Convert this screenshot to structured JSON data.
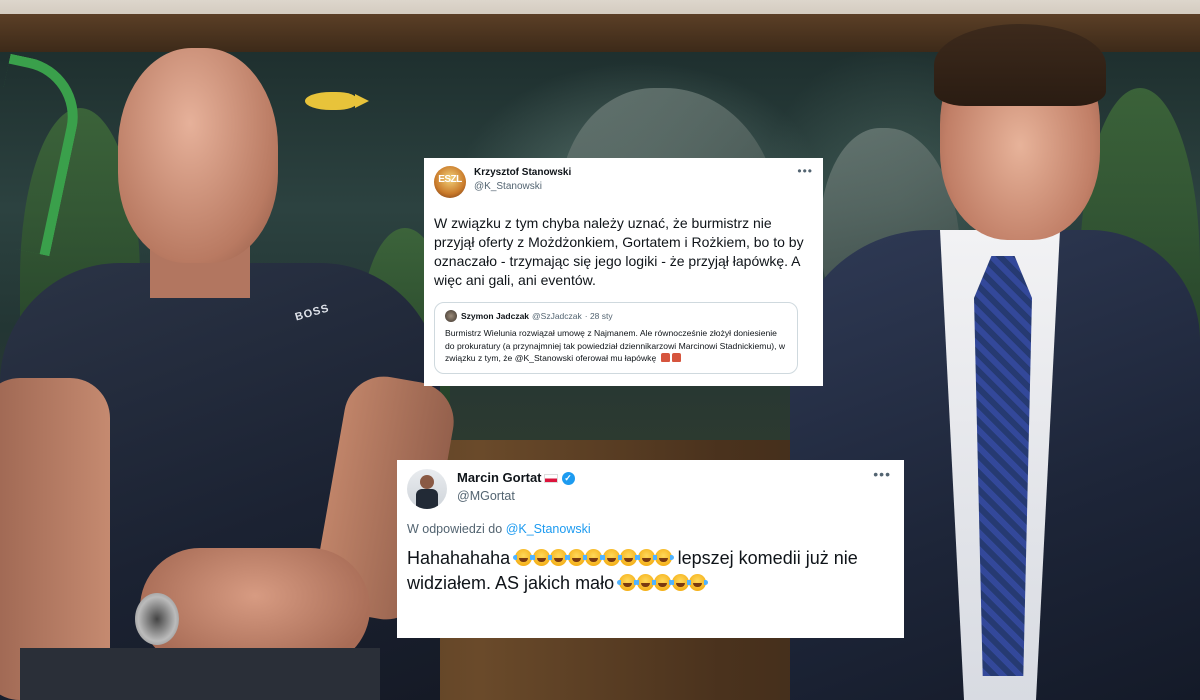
{
  "tweet1": {
    "avatar_text": "ESZL",
    "name": "Krzysztof Stanowski",
    "handle": "@K_Stanowski",
    "more": "•••",
    "text": "W związku z tym chyba należy uznać, że burmistrz nie przyjął oferty z Możdżonkiem, Gortatem i Rożkiem, bo to by oznaczało - trzymając się jego logiki - że przyjął łapówkę. A więc ani gali, ani eventów.",
    "quote": {
      "name": "Szymon Jadczak",
      "handle": "@SzJadczak",
      "date": "· 28 sty",
      "text": "Burmistrz Wielunia rozwiązał umowę z Najmanem. Ale równocześnie złożył doniesienie do prokuratury (a przynajmniej tak powiedział dziennikarzowi Marcinowi Stadnickiemu), w związku z tym, że @K_Stanowski oferował mu łapówkę"
    }
  },
  "tweet2": {
    "name": "Marcin Gortat",
    "handle": "@MGortat",
    "more": "•••",
    "reply_prefix": "W odpowiedzi do",
    "reply_mention": "@K_Stanowski",
    "text_part1": "Hahahahaha",
    "text_part2": "lepszej komedii już nie widziałem.  AS jakich mało",
    "laugh_count_1": 9,
    "laugh_count_2": 5
  },
  "photo": {
    "shirt_logo": "BOSS"
  }
}
